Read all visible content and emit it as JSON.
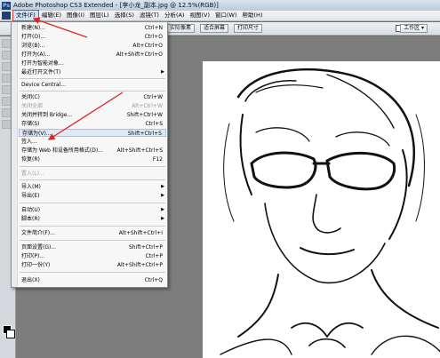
{
  "window": {
    "title": "Adobe Photoshop CS3 Extended - [李小龙_副本.jpg @ 12.5%(RGB)]"
  },
  "menubar": {
    "items": [
      "文件(F)",
      "编辑(E)",
      "图像(I)",
      "图层(L)",
      "选择(S)",
      "滤镜(T)",
      "分析(A)",
      "视图(V)",
      "窗口(W)",
      "帮助(H)"
    ]
  },
  "options": {
    "buttons": [
      "实际像素",
      "适合屏幕",
      "打印尺寸"
    ],
    "workspace": "工作区 ▾"
  },
  "file_menu": {
    "items": [
      {
        "label": "新建(N)...",
        "shortcut": "Ctrl+N"
      },
      {
        "label": "打开(O)...",
        "shortcut": "Ctrl+O"
      },
      {
        "label": "浏览(B)...",
        "shortcut": "Alt+Ctrl+O"
      },
      {
        "label": "打开为(A)...",
        "shortcut": "Alt+Shift+Ctrl+O"
      },
      {
        "label": "打开为智能对象...",
        "shortcut": ""
      },
      {
        "label": "最近打开文件(T)",
        "shortcut": "",
        "submenu": true
      },
      {
        "label": "Device Central...",
        "shortcut": ""
      },
      {
        "label": "关闭(C)",
        "shortcut": "Ctrl+W"
      },
      {
        "label": "关闭全部",
        "shortcut": "Alt+Ctrl+W",
        "disabled": true
      },
      {
        "label": "关闭并转到 Bridge...",
        "shortcut": "Shift+Ctrl+W"
      },
      {
        "label": "存储(S)",
        "shortcut": "Ctrl+S"
      },
      {
        "label": "存储为(V)...",
        "shortcut": "Shift+Ctrl+S"
      },
      {
        "label": "签入...",
        "shortcut": ""
      },
      {
        "label": "存储为 Web 和设备所用格式(D)...",
        "shortcut": "Alt+Shift+Ctrl+S"
      },
      {
        "label": "恢复(R)",
        "shortcut": "F12"
      },
      {
        "label": "置入(L)...",
        "shortcut": "",
        "disabled": true
      },
      {
        "label": "导入(M)",
        "shortcut": "",
        "submenu": true
      },
      {
        "label": "导出(E)",
        "shortcut": "",
        "submenu": true
      },
      {
        "label": "自动(U)",
        "shortcut": "",
        "submenu": true
      },
      {
        "label": "脚本(R)",
        "shortcut": "",
        "submenu": true
      },
      {
        "label": "文件简介(F)...",
        "shortcut": "Alt+Shift+Ctrl+I"
      },
      {
        "label": "页面设置(G)...",
        "shortcut": "Shift+Ctrl+P"
      },
      {
        "label": "打印(P)...",
        "shortcut": "Ctrl+P"
      },
      {
        "label": "打印一份(Y)",
        "shortcut": "Alt+Shift+Ctrl+P"
      },
      {
        "label": "退出(X)",
        "shortcut": "Ctrl+Q"
      }
    ]
  },
  "colors": {
    "annotation_arrow": "#e02424",
    "menu_highlight": "#dde9f7",
    "foreground": "#000000",
    "background": "#ffffff"
  }
}
